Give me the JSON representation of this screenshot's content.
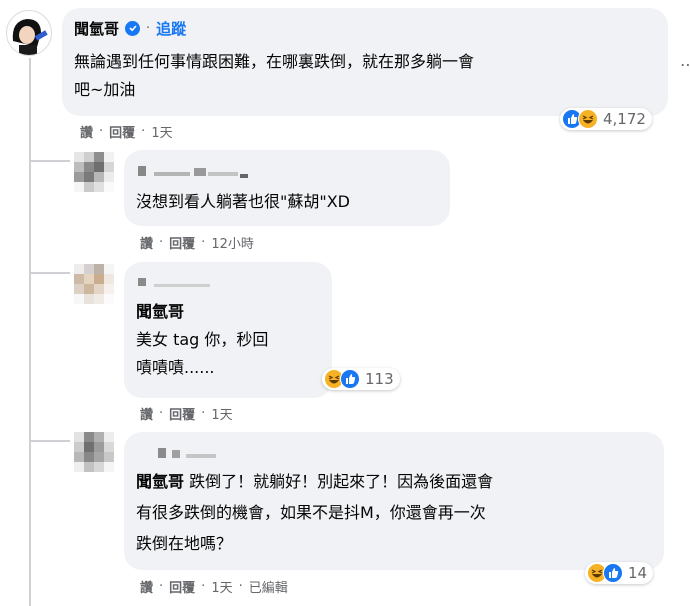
{
  "comment1": {
    "author": "聞氫哥",
    "follow": "追蹤",
    "text_line1": "無論遇到任何事情跟困難，在哪裏跌倒，就在那多躺一會",
    "text_line2": "吧~加油",
    "reaction_count": "4,172",
    "actions": {
      "like": "讚",
      "reply": "回覆",
      "time": "1天"
    }
  },
  "reply1": {
    "text": "沒想到看人躺著也很\"蘇胡\"XD",
    "actions": {
      "like": "讚",
      "reply": "回覆",
      "time": "12小時"
    }
  },
  "reply2": {
    "tag": "聞氫哥",
    "text_line1": "美女 tag 你，秒回",
    "text_line2": "嘖嘖嘖......",
    "reaction_count": "113",
    "actions": {
      "like": "讚",
      "reply": "回覆",
      "time": "1天"
    }
  },
  "reply3": {
    "tag": "聞氫哥",
    "text_line1": "跌倒了！就躺好！別起來了！因為後面還會",
    "text_line2": "有很多跌倒的機會，如果不是抖M，你還會再一次",
    "text_line3": "跌倒在地嗎？",
    "reaction_count": "14",
    "actions": {
      "like": "讚",
      "reply": "回覆",
      "time": "1天",
      "edited": "已編輯"
    }
  },
  "colors": {
    "accent": "#1877f2",
    "bubble": "#f0f2f5",
    "meta": "#65676b"
  },
  "icons": [
    "verified-badge-icon",
    "more-options-icon",
    "like-reaction-icon",
    "haha-reaction-icon"
  ]
}
